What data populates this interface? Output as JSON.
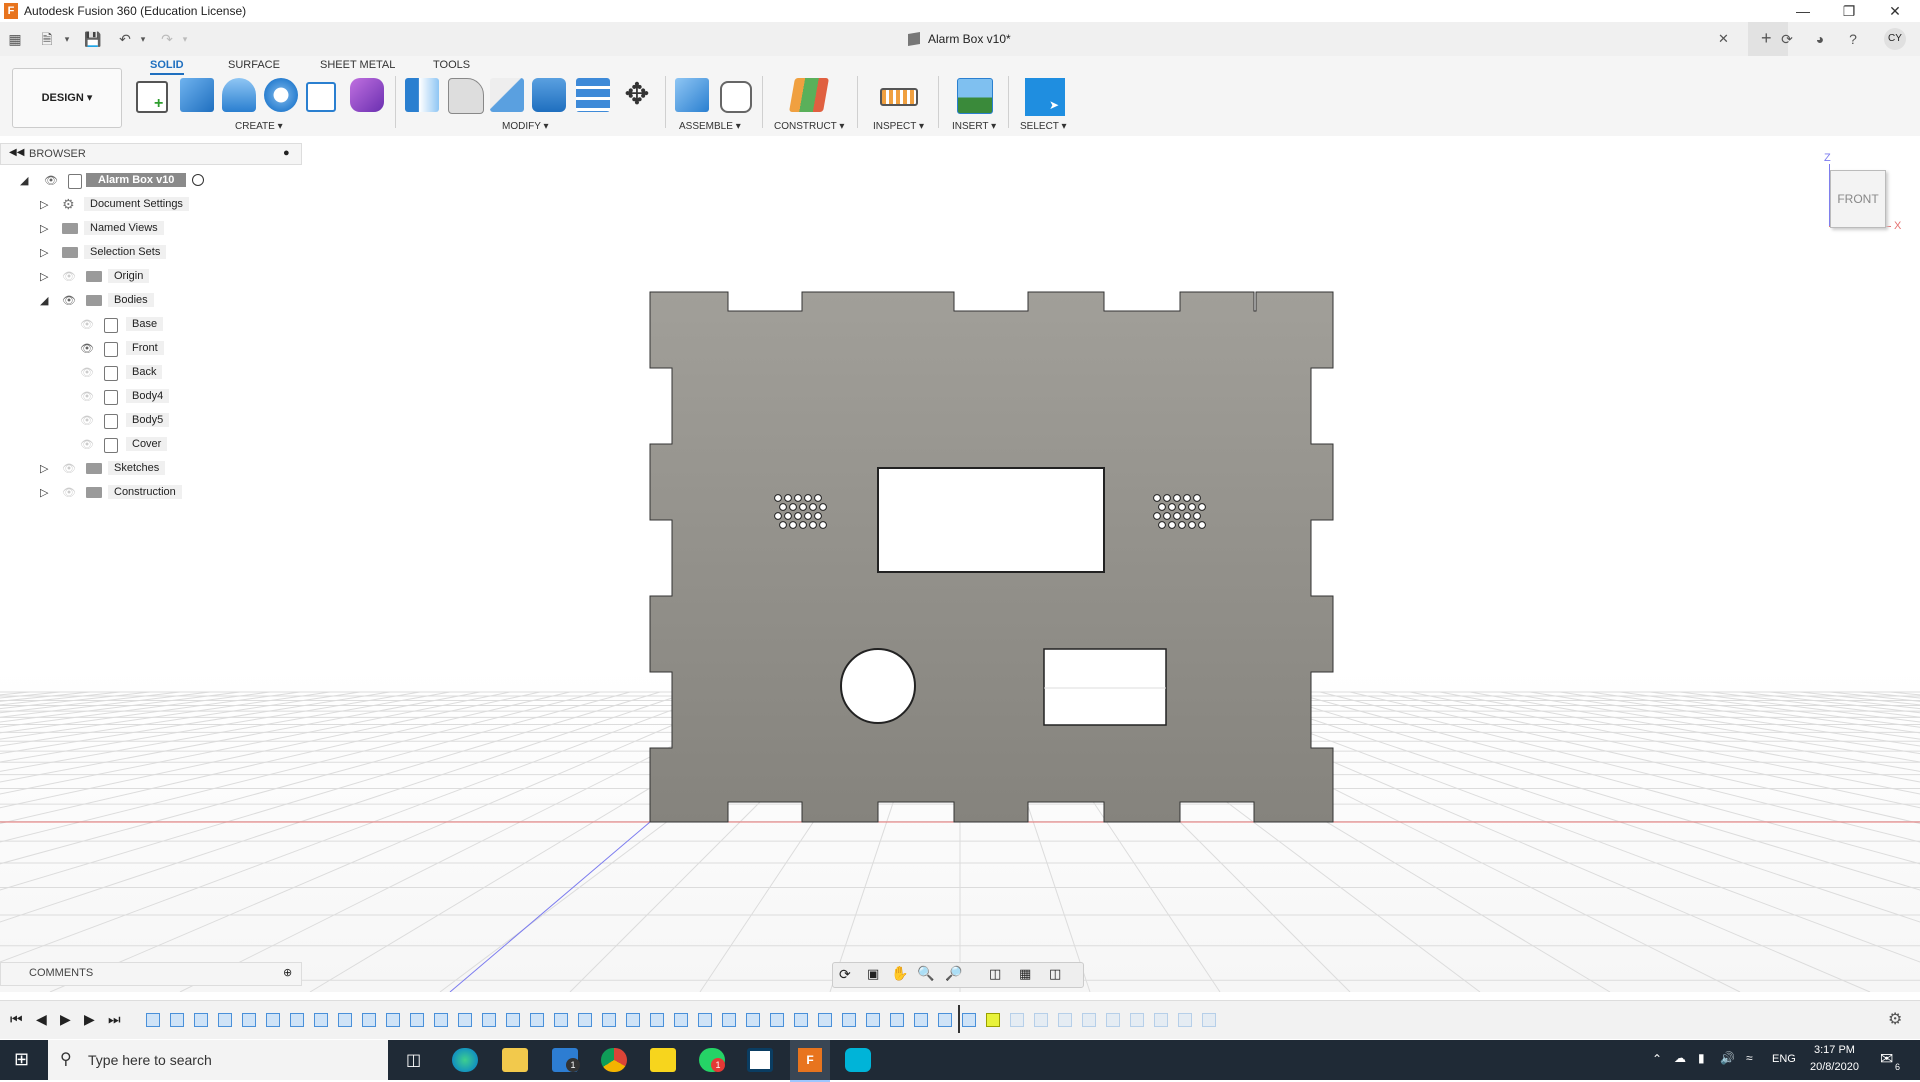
{
  "window": {
    "title": "Autodesk Fusion 360 (Education License)",
    "document_title": "Alarm Box v10*",
    "user_initials": "CY"
  },
  "ribbon": {
    "workspace": "DESIGN",
    "tabs": [
      {
        "label": "SOLID",
        "active": true
      },
      {
        "label": "SURFACE",
        "active": false
      },
      {
        "label": "SHEET METAL",
        "active": false
      },
      {
        "label": "TOOLS",
        "active": false
      }
    ],
    "groups": {
      "create": "CREATE",
      "modify": "MODIFY",
      "assemble": "ASSEMBLE",
      "construct": "CONSTRUCT",
      "inspect": "INSPECT",
      "insert": "INSERT",
      "select": "SELECT"
    }
  },
  "browser": {
    "title": "BROWSER",
    "root": "Alarm Box v10",
    "items": {
      "document_settings": "Document Settings",
      "named_views": "Named Views",
      "selection_sets": "Selection Sets",
      "origin": "Origin",
      "bodies": "Bodies",
      "body_base": "Base",
      "body_front": "Front",
      "body_back": "Back",
      "body_4": "Body4",
      "body_5": "Body5",
      "body_cover": "Cover",
      "sketches": "Sketches",
      "construction": "Construction"
    }
  },
  "viewcube": {
    "face": "FRONT",
    "axis_z": "Z",
    "axis_x": "X"
  },
  "comments": {
    "title": "COMMENTS"
  },
  "taskbar": {
    "search_placeholder": "Type here to search",
    "language": "ENG",
    "time": "3:17 PM",
    "date": "20/8/2020",
    "mail_badge": "1",
    "whatsapp_badge": "1",
    "notification_count": "6"
  },
  "colors": {
    "accent": "#1f6fbf",
    "body_gray": "#8b8a84",
    "taskbar": "#1f2a36"
  }
}
